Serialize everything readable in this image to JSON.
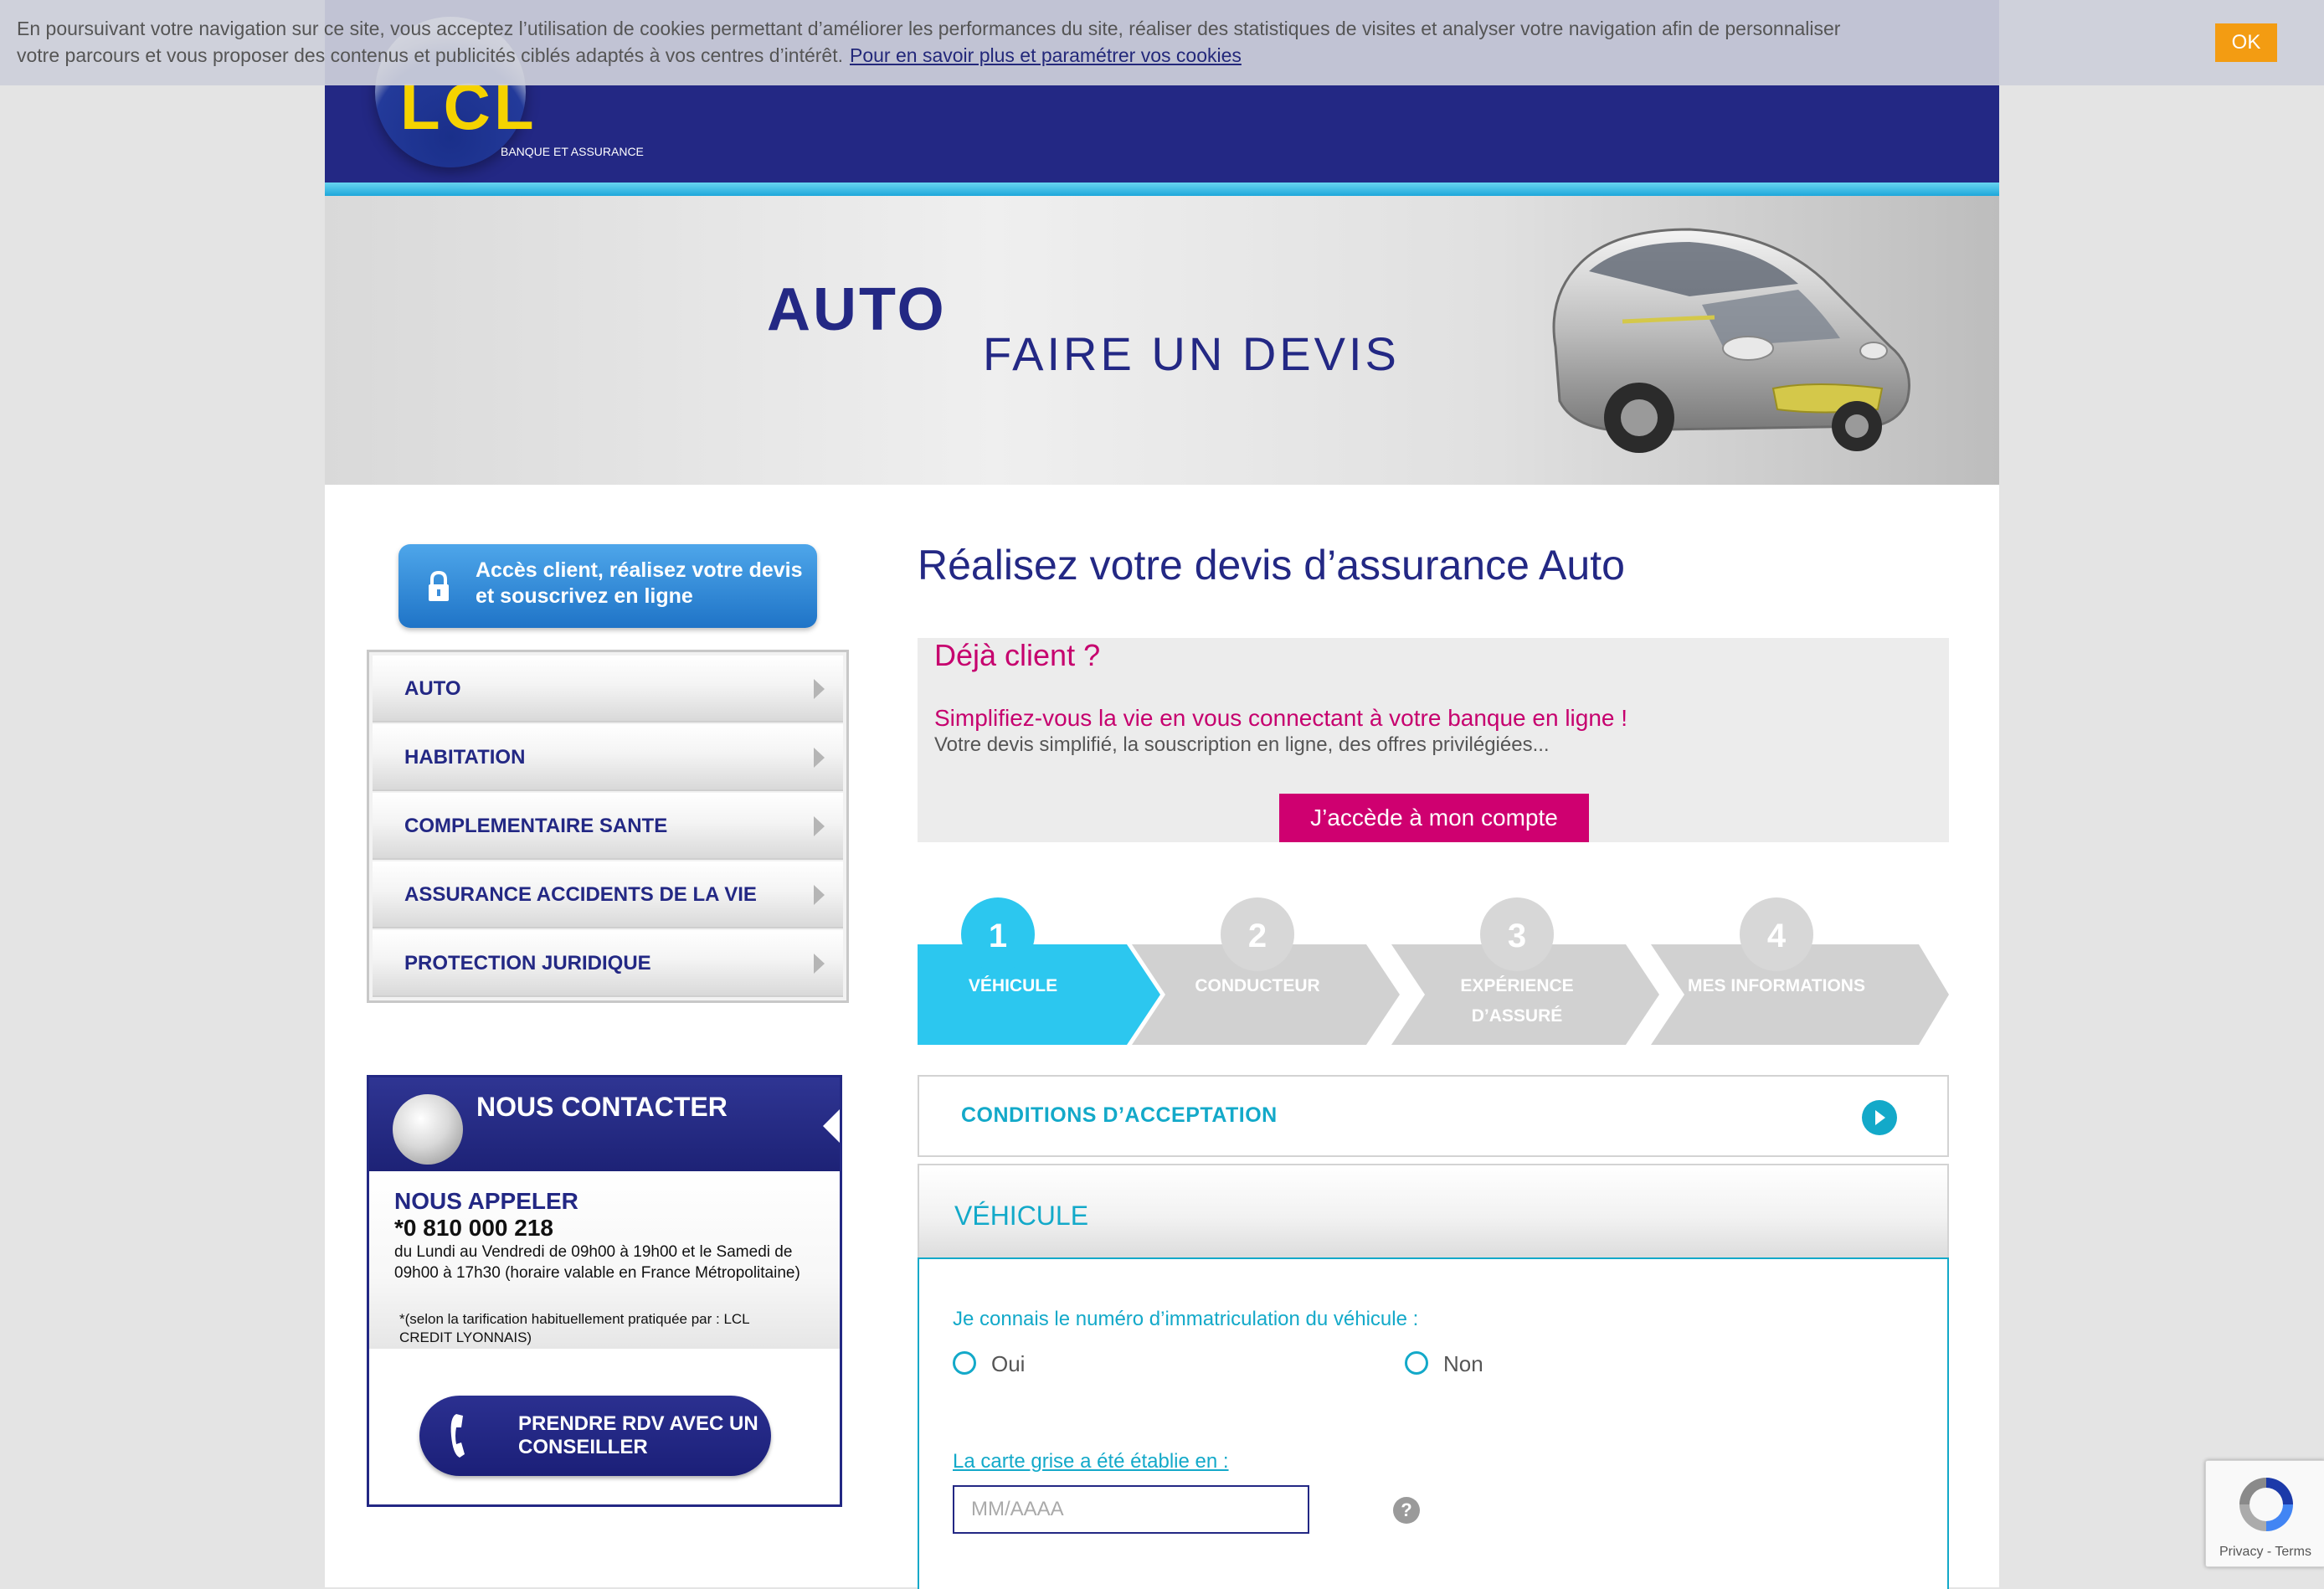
{
  "cookie": {
    "text": "En poursuivant votre navigation sur ce site, vous acceptez l’utilisation de cookies permettant d’améliorer les performances du site, réaliser des statistiques de visites et analyser votre navigation afin de personnaliser votre parcours et vous proposer des contenus et publicités ciblés adaptés à vos centres d’intérêt.",
    "link": "Pour en savoir plus et paramétrer vos cookies",
    "ok": "OK"
  },
  "logo": {
    "name": "LCL",
    "tagline": "BANQUE ET ASSURANCE"
  },
  "hero": {
    "title": "AUTO",
    "subtitle": "FAIRE UN DEVIS"
  },
  "sidebar": {
    "access_button": "Accès client, réalisez votre devis et souscrivez en ligne",
    "menu": [
      {
        "label": "AUTO"
      },
      {
        "label": "HABITATION"
      },
      {
        "label": "COMPLEMENTAIRE SANTE"
      },
      {
        "label": "ASSURANCE ACCIDENTS DE LA VIE"
      },
      {
        "label": "PROTECTION JURIDIQUE"
      }
    ]
  },
  "contact": {
    "title": "NOUS CONTACTER",
    "call_title": "NOUS APPELER",
    "phone": "*0 810 000 218",
    "hours": "du Lundi au Vendredi de 09h00 à 19h00 et le Samedi de 09h00 à 17h30 (horaire valable en France Métropolitaine)",
    "note": "*(selon la tarification habituellement pratiquée par : LCL CREDIT LYONNAIS)",
    "rdv_button": "PRENDRE RDV AVEC UN CONSEILLER"
  },
  "main": {
    "title": "Réalisez votre devis d’assurance Auto",
    "deja_client": {
      "title": "Déjà client ?",
      "subtitle": "Simplifiez-vous la vie en vous connectant à votre banque en ligne !",
      "description": "Votre devis simplifié, la souscription en ligne, des offres privilégiées...",
      "button": "J’accède à mon compte"
    },
    "steps": [
      {
        "number": "1",
        "label": "VÉHICULE",
        "active": true
      },
      {
        "number": "2",
        "label": "CONDUCTEUR",
        "active": false
      },
      {
        "number": "3",
        "label": "EXPÉRIENCE D’ASSURÉ",
        "active": false
      },
      {
        "number": "4",
        "label": "MES INFORMATIONS",
        "active": false
      }
    ],
    "conditions": "CONDITIONS D’ACCEPTATION",
    "section_title": "VÉHICULE",
    "form": {
      "q_immat": "Je connais le numéro d’immatriculation du véhicule :",
      "opt_oui": "Oui",
      "opt_non": "Non",
      "q_carte": "La carte grise a été établie en :",
      "carte_placeholder": "MM/AAAA",
      "carte_value": "",
      "help": "?"
    }
  },
  "recaptcha": {
    "text": "Privacy - Terms"
  },
  "colors": {
    "brand_blue": "#232884",
    "accent_cyan": "#13a9c9",
    "pink": "#cf0070",
    "cookie_ok": "#f39c12",
    "logo_yellow": "#f5d300"
  }
}
